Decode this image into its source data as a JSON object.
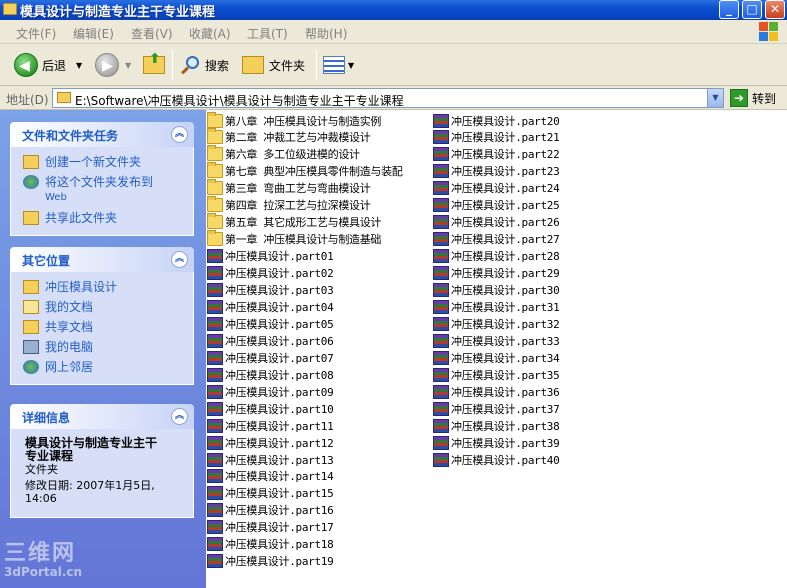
{
  "window": {
    "title": "模具设计与制造专业主干专业课程"
  },
  "menu": [
    "文件(F)",
    "编辑(E)",
    "查看(V)",
    "收藏(A)",
    "工具(T)",
    "帮助(H)"
  ],
  "toolbar": {
    "back": "后退",
    "search": "搜索",
    "folders": "文件夹"
  },
  "address": {
    "label": "地址(D)",
    "path": "E:\\Software\\冲压模具设计\\模具设计与制造专业主干专业课程",
    "go": "转到"
  },
  "panels": {
    "tasks": {
      "title": "文件和文件夹任务",
      "items": [
        "创建一个新文件夹",
        "将这个文件夹发布到",
        "Web",
        "共享此文件夹"
      ]
    },
    "places": {
      "title": "其它位置",
      "items": [
        "冲压模具设计",
        "我的文档",
        "共享文档",
        "我的电脑",
        "网上邻居"
      ]
    },
    "details": {
      "title": "详细信息",
      "name_line1": "模具设计与制造专业主干",
      "name_line2": "专业课程",
      "type": "文件夹",
      "modified_line1": "修改日期: 2007年1月5日,",
      "modified_line2": "14:06"
    }
  },
  "watermark": {
    "top": "三维网",
    "bottom": "3dPortal.cn"
  },
  "folders": [
    "第八章 冲压模具设计与制造实例",
    "第二章 冲裁工艺与冲裁模设计",
    "第六章 多工位级进模的设计",
    "第七章 典型冲压模具零件制造与装配",
    "第三章 弯曲工艺与弯曲模设计",
    "第四章 拉深工艺与拉深模设计",
    "第五章 其它成形工艺与模具设计",
    "第一章 冲压模具设计与制造基础"
  ],
  "files": [
    "冲压模具设计.part01",
    "冲压模具设计.part02",
    "冲压模具设计.part03",
    "冲压模具设计.part04",
    "冲压模具设计.part05",
    "冲压模具设计.part06",
    "冲压模具设计.part07",
    "冲压模具设计.part08",
    "冲压模具设计.part09",
    "冲压模具设计.part10",
    "冲压模具设计.part11",
    "冲压模具设计.part12",
    "冲压模具设计.part13",
    "冲压模具设计.part14",
    "冲压模具设计.part15",
    "冲压模具设计.part16",
    "冲压模具设计.part17",
    "冲压模具设计.part18",
    "冲压模具设计.part19",
    "冲压模具设计.part20",
    "冲压模具设计.part21",
    "冲压模具设计.part22",
    "冲压模具设计.part23",
    "冲压模具设计.part24",
    "冲压模具设计.part25",
    "冲压模具设计.part26",
    "冲压模具设计.part27",
    "冲压模具设计.part28",
    "冲压模具设计.part29",
    "冲压模具设计.part30",
    "冲压模具设计.part31",
    "冲压模具设计.part32",
    "冲压模具设计.part33",
    "冲压模具设计.part34",
    "冲压模具设计.part35",
    "冲压模具设计.part36",
    "冲压模具设计.part37",
    "冲压模具设计.part38",
    "冲压模具设计.part39",
    "冲压模具设计.part40"
  ]
}
